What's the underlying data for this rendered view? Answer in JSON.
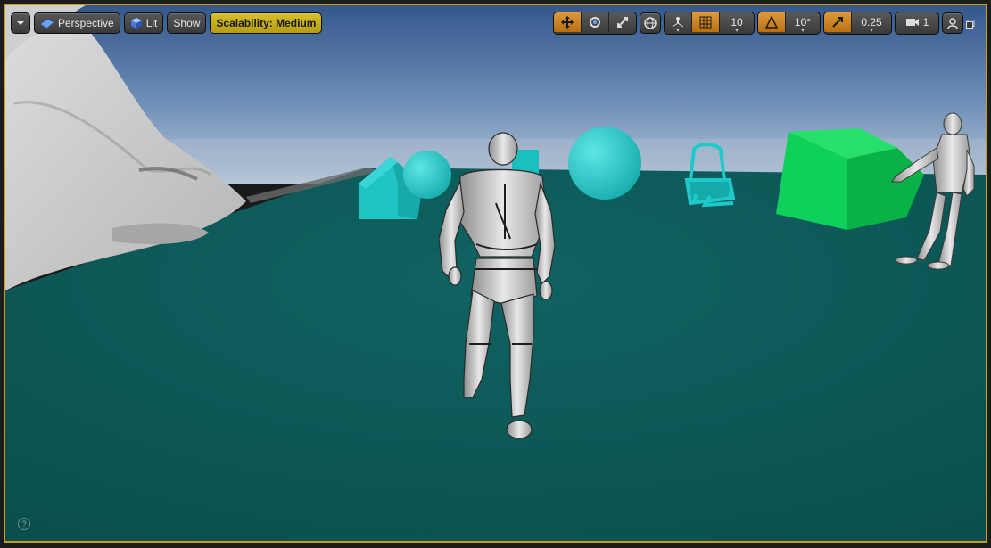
{
  "toolbar": {
    "menu_icon": "chevron-down-icon",
    "perspective_label": "Perspective",
    "lit_label": "Lit",
    "show_label": "Show",
    "scalability_label": "Scalability: Medium",
    "grid_snap_value": "10",
    "rotation_snap_value": "10°",
    "scale_snap_value": "0.25",
    "camera_speed_value": "1"
  },
  "icons": {
    "translate": "move-icon",
    "rotate": "rotate-icon",
    "scale": "scale-icon",
    "world": "globe-icon",
    "surface_snap": "surface-snap-icon",
    "grid_snap": "grid-icon",
    "rotation_snap": "angle-icon",
    "scale_snap": "scale-snap-icon",
    "camera_speed": "camera-icon",
    "layout": "layout-icon",
    "maximize": "maximize-icon",
    "help": "?"
  },
  "colors": {
    "selection_border": "#c99d1e",
    "ground": "#0f5d5c",
    "sky_top": "#3a5e92",
    "cyan_object": "#19c6c6",
    "green_cube": "#10d060"
  }
}
